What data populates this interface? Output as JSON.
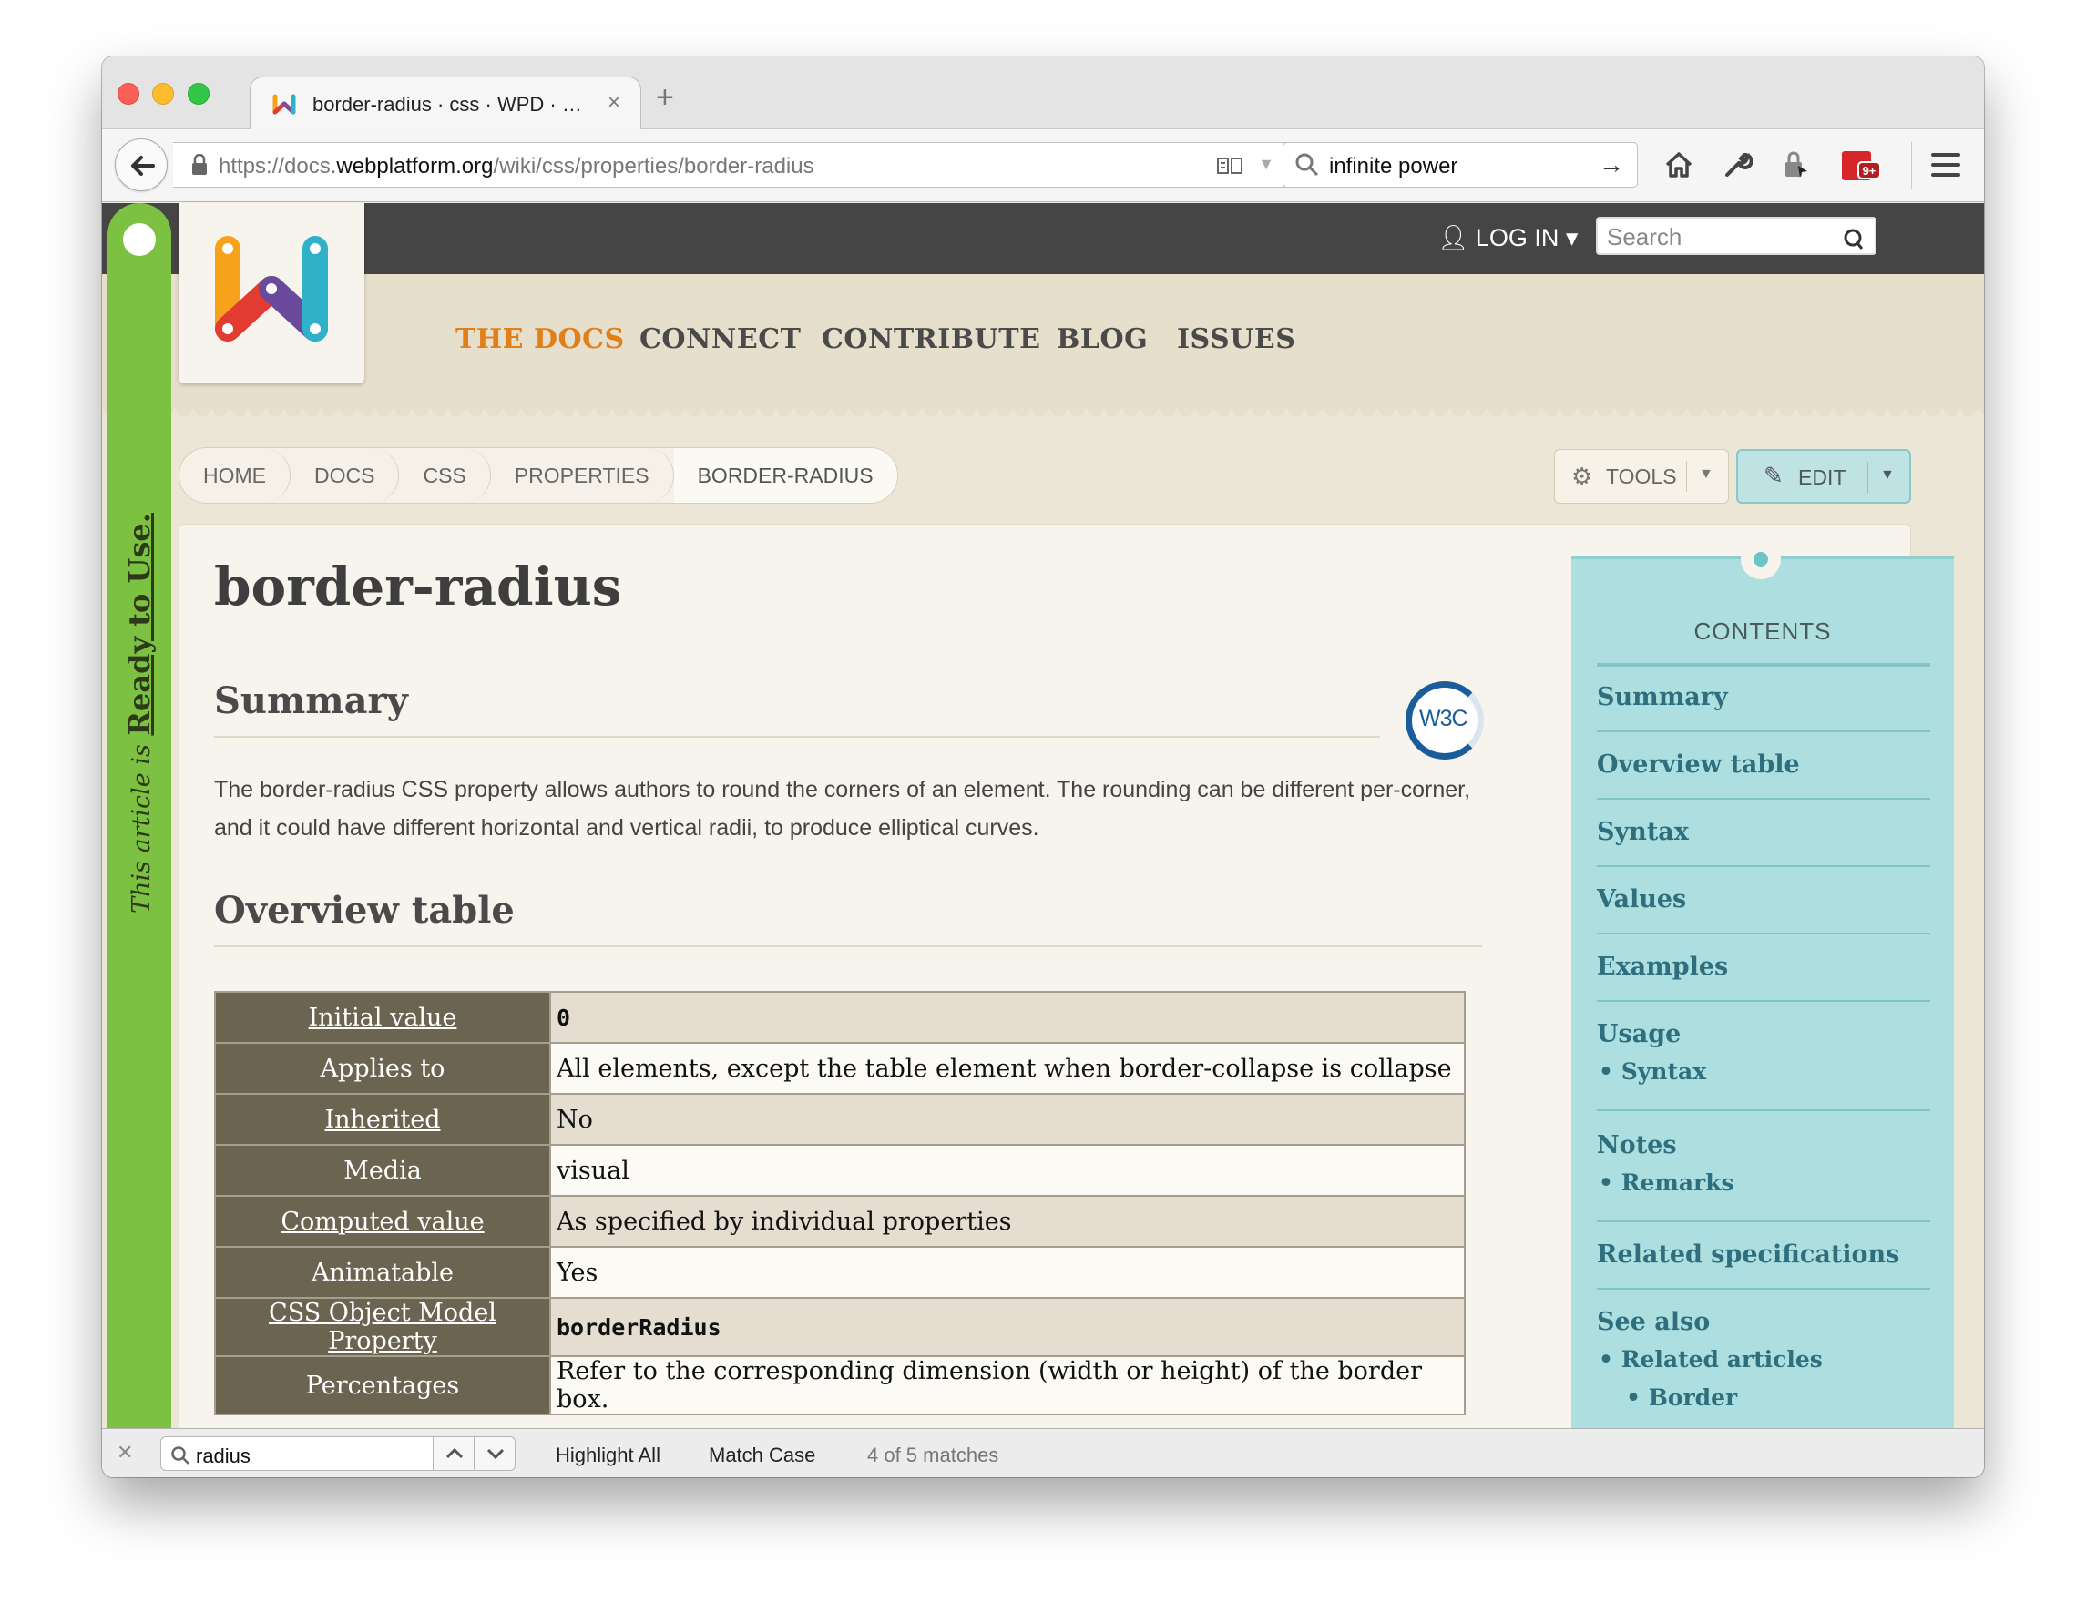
{
  "browser": {
    "tab_title": "border-radius · css · WPD · …",
    "tab_close": "×",
    "new_tab": "+",
    "url_prefix": "https://docs.",
    "url_domain": "webplatform.org",
    "url_path": "/wiki/css/properties/border-radius",
    "search_value": "infinite power",
    "icons": [
      "back-arrow-icon",
      "lock-icon",
      "reader-view-icon",
      "reload-icon",
      "search-icon",
      "go-arrow-icon",
      "home-icon",
      "wrench-icon",
      "addon-icon",
      "extension-badge-icon",
      "hamburger-menu-icon"
    ]
  },
  "site": {
    "login": "LOG IN",
    "search_placeholder": "Search",
    "nav": [
      "THE DOCS",
      "CONNECT",
      "CONTRIBUTE",
      "BLOG",
      "ISSUES"
    ],
    "active_nav": "THE DOCS",
    "ribbon_prefix": "This article is",
    "ribbon_status": "Ready to Use.",
    "breadcrumb": [
      "HOME",
      "DOCS",
      "CSS",
      "PROPERTIES",
      "BORDER-RADIUS"
    ],
    "tools_label": "TOOLS",
    "edit_label": "EDIT",
    "colors": {
      "accent_orange": "#e1801b",
      "ribbon_green": "#7dc142",
      "toc_teal": "#aedfe0",
      "table_key": "#6a6451"
    }
  },
  "article": {
    "title": "border-radius",
    "summary_heading": "Summary",
    "summary_text": "The border-radius CSS property allows authors to round the corners of an element. The rounding can be different per-corner, and it could have different horizontal and vertical radii, to produce elliptical curves.",
    "w3c_badge": "W3C",
    "overview_heading": "Overview table",
    "overview_rows": [
      {
        "key": "Initial value",
        "value": "0"
      },
      {
        "key": "Applies to",
        "value": "All elements, except the table element when border-collapse is collapse"
      },
      {
        "key": "Inherited",
        "value": "No"
      },
      {
        "key": "Media",
        "value": "visual"
      },
      {
        "key": "Computed value",
        "value": "As specified by individual properties"
      },
      {
        "key": "Animatable",
        "value": "Yes"
      },
      {
        "key": "CSS Object Model Property",
        "value": "borderRadius"
      },
      {
        "key": "Percentages",
        "value": "Refer to the corresponding dimension (width or height) of the border box."
      }
    ]
  },
  "toc": {
    "heading": "CONTENTS",
    "items": [
      "Summary",
      "Overview table",
      "Syntax",
      "Values",
      "Examples",
      "Usage",
      "Notes",
      "Related specifications",
      "See also"
    ],
    "usage_sub": [
      "Syntax"
    ],
    "notes_sub": [
      "Remarks"
    ],
    "seealso_sub": [
      "Related articles"
    ],
    "seealso_subsub": [
      "Border"
    ]
  },
  "findbar": {
    "query": "radius",
    "highlight_all": "Highlight All",
    "match_case": "Match Case",
    "status": "4 of 5 matches"
  }
}
